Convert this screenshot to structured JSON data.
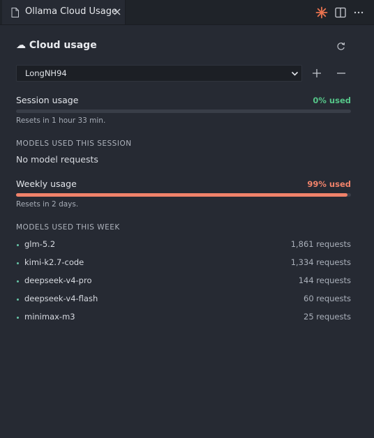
{
  "tab": {
    "title": "Ollama Cloud Usage"
  },
  "panel": {
    "heading": "☁ Cloud usage"
  },
  "account": {
    "selected": "LongNH94"
  },
  "session": {
    "label": "Session usage",
    "percent_text": "0% used",
    "percent": 0,
    "reset_text": "Resets in 1 hour 33 min.",
    "models_heading": "MODELS USED THIS SESSION",
    "empty_text": "No model requests"
  },
  "weekly": {
    "label": "Weekly usage",
    "percent_text": "99% used",
    "percent": 99,
    "reset_text": "Resets in 2 days.",
    "models_heading": "MODELS USED THIS WEEK",
    "models": [
      {
        "name": "glm-5.2",
        "requests": "1,861 requests"
      },
      {
        "name": "kimi-k2.7-code",
        "requests": "1,334 requests"
      },
      {
        "name": "deepseek-v4-pro",
        "requests": "144 requests"
      },
      {
        "name": "deepseek-v4-flash",
        "requests": "60 requests"
      },
      {
        "name": "minimax-m3",
        "requests": "25 requests"
      }
    ]
  },
  "colors": {
    "ok_green": "#55c488",
    "warn_orange": "#f0826a",
    "accent_icon": "#e8734f"
  },
  "icons": {
    "tab": "file-icon",
    "close": "close-icon",
    "agent": "sparkle-icon",
    "split": "split-editor-icon",
    "more": "more-icon",
    "refresh": "refresh-icon",
    "add": "plus-icon",
    "remove": "minus-icon"
  }
}
